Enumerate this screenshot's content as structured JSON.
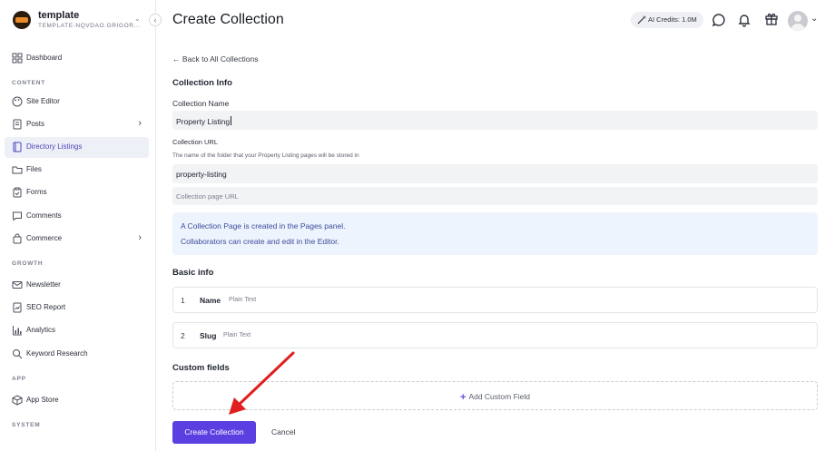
{
  "brand": {
    "name": "template",
    "subtitle": "TEMPLATE-NQVDAO.GRIGOR..."
  },
  "sidebar": {
    "items": [
      {
        "label": "Dashboard",
        "icon": "grid-icon"
      },
      {
        "label": "Site Editor",
        "icon": "palette-icon"
      },
      {
        "label": "Posts",
        "icon": "document-icon",
        "has_submenu": true
      },
      {
        "label": "Directory Listings",
        "icon": "book-icon",
        "active": true
      },
      {
        "label": "Files",
        "icon": "folder-icon"
      },
      {
        "label": "Forms",
        "icon": "clipboard-icon"
      },
      {
        "label": "Comments",
        "icon": "comment-icon"
      },
      {
        "label": "Commerce",
        "icon": "shopping-bag-icon",
        "has_submenu": true
      },
      {
        "label": "Newsletter",
        "icon": "mail-icon"
      },
      {
        "label": "SEO Report",
        "icon": "chart-file-icon"
      },
      {
        "label": "Analytics",
        "icon": "bar-chart-icon"
      },
      {
        "label": "Keyword Research",
        "icon": "search-icon"
      },
      {
        "label": "App Store",
        "icon": "box-icon"
      }
    ],
    "sections": [
      "CONTENT",
      "GROWTH",
      "APP",
      "SYSTEM"
    ]
  },
  "header": {
    "title": "Create Collection",
    "credits": "AI Credits: 1.0M"
  },
  "main": {
    "back_link": "← Back to All Collections",
    "collection_info_heading": "Collection Info",
    "collection_name_label": "Collection Name",
    "collection_name_value": "Property Listing",
    "collection_url_label": "Collection URL",
    "collection_url_help": "The name of the folder that your Property Listing pages will be stored in",
    "collection_url_value": "property-listing",
    "collection_page_url_placeholder": "Collection page URL",
    "info_lines": [
      "A Collection Page is created in the Pages panel.",
      "Collaborators can create and edit in the Editor."
    ],
    "basic_info_heading": "Basic info",
    "fields": [
      {
        "num": "1",
        "name": "Name",
        "type": "Plain Text"
      },
      {
        "num": "2",
        "name": "Slug",
        "type": "Plain Text"
      }
    ],
    "custom_fields_heading": "Custom fields",
    "add_custom_field": "Add Custom Field",
    "create_button": "Create Collection",
    "cancel_button": "Cancel"
  },
  "colors": {
    "accent": "#5b3fe0",
    "info_bg": "#eef4fd",
    "annotation_arrow": "#e02020"
  }
}
